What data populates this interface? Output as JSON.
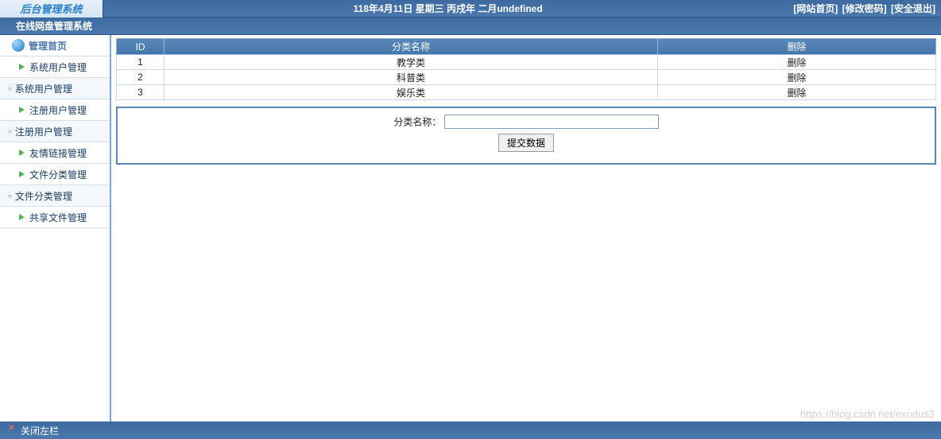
{
  "logo": "后台管理系统",
  "date_info": "118年4月11日 星期三 丙戌年 二月undefined",
  "top_links": {
    "home": "[网站首页]",
    "pwd": "[修改密码]",
    "logout": "[安全退出]"
  },
  "subbar_title": "在线网盘管理系统",
  "menu": {
    "home": "管理首页",
    "items": [
      {
        "label": "系统用户管理",
        "type": "child"
      },
      {
        "label": "系统用户管理",
        "type": "parent"
      },
      {
        "label": "注册用户管理",
        "type": "child"
      },
      {
        "label": "注册用户管理",
        "type": "parent"
      },
      {
        "label": "友情链接管理",
        "type": "child"
      },
      {
        "label": "文件分类管理",
        "type": "child"
      },
      {
        "label": "文件分类管理",
        "type": "parent"
      },
      {
        "label": "共享文件管理",
        "type": "child"
      }
    ]
  },
  "table": {
    "headers": {
      "id": "ID",
      "name": "分类名称",
      "del": "删除"
    },
    "rows": [
      {
        "id": "1",
        "name": "教学类",
        "del": "删除"
      },
      {
        "id": "2",
        "name": "科普类",
        "del": "删除"
      },
      {
        "id": "3",
        "name": "娱乐类",
        "del": "删除"
      }
    ]
  },
  "form": {
    "label": "分类名称：",
    "value": "",
    "submit": "提交数据"
  },
  "footer": {
    "close": "关闭左栏"
  },
  "watermark": "https://blog.csdn.net/exodus3"
}
